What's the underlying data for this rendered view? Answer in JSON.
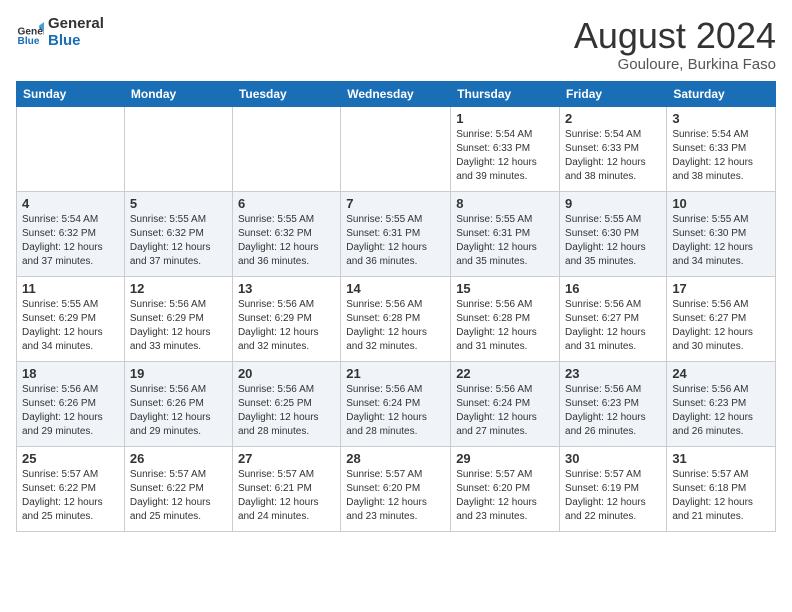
{
  "header": {
    "logo_line1": "General",
    "logo_line2": "Blue",
    "month_title": "August 2024",
    "location": "Gouloure, Burkina Faso"
  },
  "weekdays": [
    "Sunday",
    "Monday",
    "Tuesday",
    "Wednesday",
    "Thursday",
    "Friday",
    "Saturday"
  ],
  "weeks": [
    [
      {
        "day": "",
        "info": ""
      },
      {
        "day": "",
        "info": ""
      },
      {
        "day": "",
        "info": ""
      },
      {
        "day": "",
        "info": ""
      },
      {
        "day": "1",
        "info": "Sunrise: 5:54 AM\nSunset: 6:33 PM\nDaylight: 12 hours\nand 39 minutes."
      },
      {
        "day": "2",
        "info": "Sunrise: 5:54 AM\nSunset: 6:33 PM\nDaylight: 12 hours\nand 38 minutes."
      },
      {
        "day": "3",
        "info": "Sunrise: 5:54 AM\nSunset: 6:33 PM\nDaylight: 12 hours\nand 38 minutes."
      }
    ],
    [
      {
        "day": "4",
        "info": "Sunrise: 5:54 AM\nSunset: 6:32 PM\nDaylight: 12 hours\nand 37 minutes."
      },
      {
        "day": "5",
        "info": "Sunrise: 5:55 AM\nSunset: 6:32 PM\nDaylight: 12 hours\nand 37 minutes."
      },
      {
        "day": "6",
        "info": "Sunrise: 5:55 AM\nSunset: 6:32 PM\nDaylight: 12 hours\nand 36 minutes."
      },
      {
        "day": "7",
        "info": "Sunrise: 5:55 AM\nSunset: 6:31 PM\nDaylight: 12 hours\nand 36 minutes."
      },
      {
        "day": "8",
        "info": "Sunrise: 5:55 AM\nSunset: 6:31 PM\nDaylight: 12 hours\nand 35 minutes."
      },
      {
        "day": "9",
        "info": "Sunrise: 5:55 AM\nSunset: 6:30 PM\nDaylight: 12 hours\nand 35 minutes."
      },
      {
        "day": "10",
        "info": "Sunrise: 5:55 AM\nSunset: 6:30 PM\nDaylight: 12 hours\nand 34 minutes."
      }
    ],
    [
      {
        "day": "11",
        "info": "Sunrise: 5:55 AM\nSunset: 6:29 PM\nDaylight: 12 hours\nand 34 minutes."
      },
      {
        "day": "12",
        "info": "Sunrise: 5:56 AM\nSunset: 6:29 PM\nDaylight: 12 hours\nand 33 minutes."
      },
      {
        "day": "13",
        "info": "Sunrise: 5:56 AM\nSunset: 6:29 PM\nDaylight: 12 hours\nand 32 minutes."
      },
      {
        "day": "14",
        "info": "Sunrise: 5:56 AM\nSunset: 6:28 PM\nDaylight: 12 hours\nand 32 minutes."
      },
      {
        "day": "15",
        "info": "Sunrise: 5:56 AM\nSunset: 6:28 PM\nDaylight: 12 hours\nand 31 minutes."
      },
      {
        "day": "16",
        "info": "Sunrise: 5:56 AM\nSunset: 6:27 PM\nDaylight: 12 hours\nand 31 minutes."
      },
      {
        "day": "17",
        "info": "Sunrise: 5:56 AM\nSunset: 6:27 PM\nDaylight: 12 hours\nand 30 minutes."
      }
    ],
    [
      {
        "day": "18",
        "info": "Sunrise: 5:56 AM\nSunset: 6:26 PM\nDaylight: 12 hours\nand 29 minutes."
      },
      {
        "day": "19",
        "info": "Sunrise: 5:56 AM\nSunset: 6:26 PM\nDaylight: 12 hours\nand 29 minutes."
      },
      {
        "day": "20",
        "info": "Sunrise: 5:56 AM\nSunset: 6:25 PM\nDaylight: 12 hours\nand 28 minutes."
      },
      {
        "day": "21",
        "info": "Sunrise: 5:56 AM\nSunset: 6:24 PM\nDaylight: 12 hours\nand 28 minutes."
      },
      {
        "day": "22",
        "info": "Sunrise: 5:56 AM\nSunset: 6:24 PM\nDaylight: 12 hours\nand 27 minutes."
      },
      {
        "day": "23",
        "info": "Sunrise: 5:56 AM\nSunset: 6:23 PM\nDaylight: 12 hours\nand 26 minutes."
      },
      {
        "day": "24",
        "info": "Sunrise: 5:56 AM\nSunset: 6:23 PM\nDaylight: 12 hours\nand 26 minutes."
      }
    ],
    [
      {
        "day": "25",
        "info": "Sunrise: 5:57 AM\nSunset: 6:22 PM\nDaylight: 12 hours\nand 25 minutes."
      },
      {
        "day": "26",
        "info": "Sunrise: 5:57 AM\nSunset: 6:22 PM\nDaylight: 12 hours\nand 25 minutes."
      },
      {
        "day": "27",
        "info": "Sunrise: 5:57 AM\nSunset: 6:21 PM\nDaylight: 12 hours\nand 24 minutes."
      },
      {
        "day": "28",
        "info": "Sunrise: 5:57 AM\nSunset: 6:20 PM\nDaylight: 12 hours\nand 23 minutes."
      },
      {
        "day": "29",
        "info": "Sunrise: 5:57 AM\nSunset: 6:20 PM\nDaylight: 12 hours\nand 23 minutes."
      },
      {
        "day": "30",
        "info": "Sunrise: 5:57 AM\nSunset: 6:19 PM\nDaylight: 12 hours\nand 22 minutes."
      },
      {
        "day": "31",
        "info": "Sunrise: 5:57 AM\nSunset: 6:18 PM\nDaylight: 12 hours\nand 21 minutes."
      }
    ]
  ]
}
